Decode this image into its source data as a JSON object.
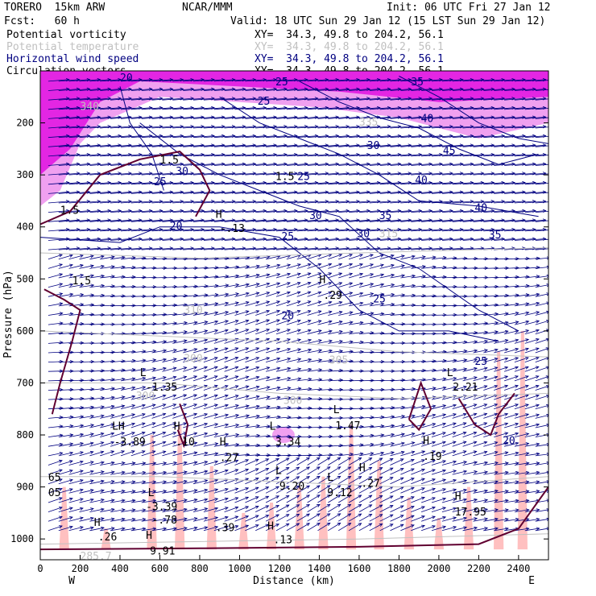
{
  "header": {
    "model": "TORERO  15km ARW",
    "org": "NCAR/MMM",
    "init": "Init: 06 UTC Fri 27 Jan 12",
    "fcst": "Fcst:   60 h",
    "valid": "Valid: 18 UTC Sun 29 Jan 12 (15 LST Sun 29 Jan 12)"
  },
  "legend": [
    {
      "name": "Potential vorticity",
      "xy": "XY=  34.3, 49.8 to 204.2, 56.1",
      "color": "#000000"
    },
    {
      "name": "Potential temperature",
      "xy": "XY=  34.3, 49.8 to 204.2, 56.1",
      "color": "#c0c0c0"
    },
    {
      "name": "Horizontal wind speed",
      "xy": "XY=  34.3, 49.8 to 204.2, 56.1",
      "color": "#000080"
    },
    {
      "name": "Circulation vectors",
      "xy": "XY=  34.3, 49.8 to 204.2, 56.1",
      "color": "#000000"
    }
  ],
  "chart_data": {
    "type": "cross-section",
    "xlabel": "Distance (km)",
    "ylabel": "Pressure (hPa)",
    "xlim": [
      0,
      2550
    ],
    "ylim": [
      100,
      1040
    ],
    "x_ticks": [
      0,
      200,
      400,
      600,
      800,
      1000,
      1200,
      1400,
      1600,
      1800,
      2000,
      2200,
      2400
    ],
    "y_ticks": [
      200,
      300,
      400,
      500,
      600,
      700,
      800,
      900,
      1000
    ],
    "x_end_labels": {
      "left": "W",
      "right": "E"
    },
    "colors": {
      "pv_fill_high": "#e010e0",
      "pv_fill_mid": "#f0a0f0",
      "pv_fill_low": "#ffc0c0",
      "wind_contour": "#000080",
      "theta_contour": "#c0c0c0",
      "pv_contour": "#600030",
      "vectors": "#000080"
    },
    "annotations": [
      {
        "text": "20",
        "x": 400,
        "p": 120,
        "color": "#000080"
      },
      {
        "text": "340",
        "x": 200,
        "p": 175,
        "color": "#c0c0c0"
      },
      {
        "text": "25",
        "x": 1180,
        "p": 128,
        "color": "#000080"
      },
      {
        "text": "25",
        "x": 1090,
        "p": 165,
        "color": "#000080"
      },
      {
        "text": "335",
        "x": 1600,
        "p": 205,
        "color": "#c0c0c0"
      },
      {
        "text": "40",
        "x": 1910,
        "p": 198,
        "color": "#000080"
      },
      {
        "text": "35",
        "x": 1860,
        "p": 128,
        "color": "#000080"
      },
      {
        "text": "30",
        "x": 1640,
        "p": 250,
        "color": "#000080"
      },
      {
        "text": "45",
        "x": 2020,
        "p": 260,
        "color": "#000080"
      },
      {
        "text": "40",
        "x": 1880,
        "p": 317,
        "color": "#000080"
      },
      {
        "text": "1.5",
        "x": 600,
        "p": 278,
        "color": "#000000"
      },
      {
        "text": "30",
        "x": 680,
        "p": 300,
        "color": "#000080"
      },
      {
        "text": "25",
        "x": 570,
        "p": 320,
        "color": "#000080"
      },
      {
        "text": "1.5",
        "x": 1180,
        "p": 310,
        "color": "#000000"
      },
      {
        "text": "25",
        "x": 1290,
        "p": 310,
        "color": "#000080"
      },
      {
        "text": "40",
        "x": 2180,
        "p": 370,
        "color": "#000080"
      },
      {
        "text": "30",
        "x": 1350,
        "p": 385,
        "color": "#000080"
      },
      {
        "text": "35",
        "x": 1700,
        "p": 385,
        "color": "#000080"
      },
      {
        "text": "H",
        "x": 880,
        "p": 383,
        "color": "#000000"
      },
      {
        "text": "-.13",
        "x": 900,
        "p": 410,
        "color": "#000000"
      },
      {
        "text": "20",
        "x": 650,
        "p": 405,
        "color": "#000080"
      },
      {
        "text": "25",
        "x": 1210,
        "p": 425,
        "color": "#000080"
      },
      {
        "text": "30",
        "x": 1590,
        "p": 420,
        "color": "#000080"
      },
      {
        "text": "315",
        "x": 1700,
        "p": 420,
        "color": "#c0c0c0"
      },
      {
        "text": "35",
        "x": 2250,
        "p": 422,
        "color": "#000080"
      },
      {
        "text": "1.5",
        "x": 100,
        "p": 375,
        "color": "#000000"
      },
      {
        "text": "1.5",
        "x": 160,
        "p": 510,
        "color": "#000000"
      },
      {
        "text": "H",
        "x": 1400,
        "p": 508,
        "color": "#000000"
      },
      {
        "text": ".29",
        "x": 1420,
        "p": 538,
        "color": "#000000"
      },
      {
        "text": "25",
        "x": 1670,
        "p": 545,
        "color": "#000080"
      },
      {
        "text": "20",
        "x": 1210,
        "p": 578,
        "color": "#000080"
      },
      {
        "text": "310",
        "x": 720,
        "p": 567,
        "color": "#c0c0c0"
      },
      {
        "text": "300",
        "x": 720,
        "p": 660,
        "color": "#c0c0c0"
      },
      {
        "text": "305",
        "x": 1450,
        "p": 663,
        "color": "#c0c0c0"
      },
      {
        "text": "25",
        "x": 2180,
        "p": 665,
        "color": "#000080"
      },
      {
        "text": "L",
        "x": 500,
        "p": 687,
        "color": "#000000"
      },
      {
        "text": "-1.35",
        "x": 530,
        "p": 715,
        "color": "#000000"
      },
      {
        "text": "300",
        "x": 480,
        "p": 732,
        "color": "#c0c0c0"
      },
      {
        "text": "300",
        "x": 1220,
        "p": 740,
        "color": "#c0c0c0"
      },
      {
        "text": "L",
        "x": 2040,
        "p": 687,
        "color": "#000000"
      },
      {
        "text": "2.21",
        "x": 2070,
        "p": 715,
        "color": "#000000"
      },
      {
        "text": "L",
        "x": 1470,
        "p": 758,
        "color": "#000000"
      },
      {
        "text": "1.47",
        "x": 1480,
        "p": 789,
        "color": "#000000"
      },
      {
        "text": "L",
        "x": 1150,
        "p": 790,
        "color": "#000000"
      },
      {
        "text": "3.34",
        "x": 1180,
        "p": 820,
        "color": "#000000"
      },
      {
        "text": "LH",
        "x": 360,
        "p": 790,
        "color": "#000000"
      },
      {
        "text": "-3.89",
        "x": 370,
        "p": 820,
        "color": "#000000"
      },
      {
        "text": "H",
        "x": 670,
        "p": 790,
        "color": "#000000"
      },
      {
        "text": ".10",
        "x": 680,
        "p": 820,
        "color": "#000000"
      },
      {
        "text": "H",
        "x": 900,
        "p": 820,
        "color": "#000000"
      },
      {
        "text": ".27",
        "x": 900,
        "p": 850,
        "color": "#000000"
      },
      {
        "text": "H",
        "x": 1920,
        "p": 818,
        "color": "#000000"
      },
      {
        "text": ".19",
        "x": 1920,
        "p": 848,
        "color": "#000000"
      },
      {
        "text": "20",
        "x": 2320,
        "p": 818,
        "color": "#000080"
      },
      {
        "text": "L",
        "x": 1180,
        "p": 875,
        "color": "#000000"
      },
      {
        "text": "9.20",
        "x": 1200,
        "p": 905,
        "color": "#000000"
      },
      {
        "text": "L",
        "x": 1440,
        "p": 888,
        "color": "#000000"
      },
      {
        "text": "9.12",
        "x": 1440,
        "p": 918,
        "color": "#000000"
      },
      {
        "text": "H",
        "x": 1600,
        "p": 870,
        "color": "#000000"
      },
      {
        "text": ".27",
        "x": 1610,
        "p": 900,
        "color": "#000000"
      },
      {
        "text": "65",
        "x": 40,
        "p": 888,
        "color": "#000000"
      },
      {
        "text": "05",
        "x": 40,
        "p": 918,
        "color": "#000000"
      },
      {
        "text": "L",
        "x": 540,
        "p": 918,
        "color": "#000000"
      },
      {
        "text": "-3.39",
        "x": 530,
        "p": 945,
        "color": "#000000"
      },
      {
        "text": "-.78",
        "x": 560,
        "p": 970,
        "color": "#000000"
      },
      {
        "text": "H",
        "x": 2080,
        "p": 925,
        "color": "#000000"
      },
      {
        "text": "17.95",
        "x": 2080,
        "p": 955,
        "color": "#000000"
      },
      {
        "text": "H",
        "x": 270,
        "p": 975,
        "color": "#000000"
      },
      {
        "text": ".26",
        "x": 290,
        "p": 1003,
        "color": "#000000"
      },
      {
        "text": "H",
        "x": 530,
        "p": 1000,
        "color": "#000000"
      },
      {
        "text": "9.91",
        "x": 550,
        "p": 1030,
        "color": "#000000"
      },
      {
        "text": ".39",
        "x": 880,
        "p": 985,
        "color": "#000000"
      },
      {
        "text": "H",
        "x": 1140,
        "p": 982,
        "color": "#000000"
      },
      {
        "text": ".13",
        "x": 1170,
        "p": 1008,
        "color": "#000000"
      },
      {
        "text": "285.7",
        "x": 200,
        "p": 1040,
        "color": "#c0c0c0"
      }
    ]
  }
}
